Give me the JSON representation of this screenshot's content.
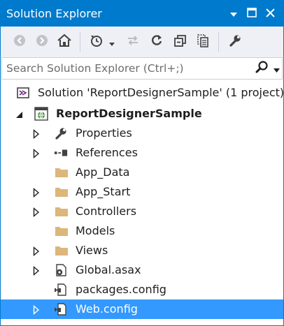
{
  "window": {
    "title": "Solution Explorer",
    "controls": [
      "dropdown",
      "maximize",
      "close"
    ]
  },
  "toolbar": {
    "buttons": [
      "back-icon",
      "forward-icon",
      "home-icon",
      "pending-changes-icon",
      "sync-icon",
      "refresh-icon",
      "collapse-all-icon",
      "show-all-files-icon",
      "properties-wrench-icon"
    ]
  },
  "search": {
    "placeholder": "Search Solution Explorer (Ctrl+;)"
  },
  "tree": {
    "solution": "Solution 'ReportDesignerSample' (1 project)",
    "project": "ReportDesignerSample",
    "items": [
      {
        "label": "Properties",
        "icon": "wrench-icon",
        "expandable": true
      },
      {
        "label": "References",
        "icon": "references-icon",
        "expandable": true
      },
      {
        "label": "App_Data",
        "icon": "folder-icon",
        "expandable": false
      },
      {
        "label": "App_Start",
        "icon": "folder-icon",
        "expandable": true
      },
      {
        "label": "Controllers",
        "icon": "folder-icon",
        "expandable": true
      },
      {
        "label": "Models",
        "icon": "folder-icon",
        "expandable": false
      },
      {
        "label": "Views",
        "icon": "folder-icon",
        "expandable": true
      },
      {
        "label": "Global.asax",
        "icon": "global-asax-icon",
        "expandable": true
      },
      {
        "label": "packages.config",
        "icon": "config-file-icon",
        "expandable": false
      },
      {
        "label": "Web.config",
        "icon": "config-file-icon",
        "expandable": true,
        "selected": true
      }
    ]
  },
  "colors": {
    "accent": "#007acc",
    "selection": "#3399ff",
    "folder": "#dcb67a",
    "toolbar_bg": "#eef0f6"
  }
}
